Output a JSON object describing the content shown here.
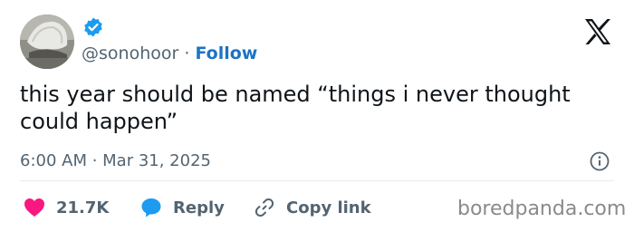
{
  "author": {
    "handle": "@sonohoor",
    "separator": "·",
    "follow_label": "Follow",
    "verified_icon": "verified-badge-icon",
    "badge_color": "#1d9bf0"
  },
  "tweet": {
    "text": "this year should be named “things i never thought could happen”",
    "timestamp": "6:00 AM · Mar 31, 2025"
  },
  "actions": {
    "like_count": "21.7K",
    "reply_label": "Reply",
    "copy_label": "Copy link"
  },
  "icons": {
    "brand": "x-logo-icon",
    "info": "info-icon",
    "like": "heart-icon",
    "reply": "speech-bubble-icon",
    "copy": "link-icon"
  },
  "colors": {
    "heart": "#f91880",
    "reply_bubble": "#1d9bf0",
    "follow": "#1d73c4",
    "secondary_text": "#536471"
  },
  "watermark": "boredpanda.com"
}
